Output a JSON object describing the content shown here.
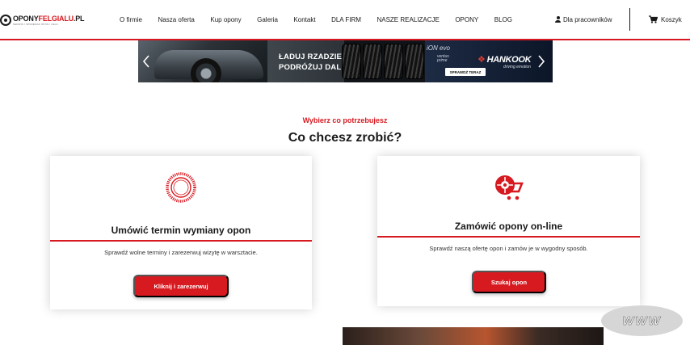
{
  "brand": {
    "title_dark": "OPONY",
    "title_red": "FELGIALU",
    "title_suffix": ".PL",
    "subtitle": "SERWIS I SPRZEDAŻ OPON I FELG",
    "accent_color": "#d71920"
  },
  "nav": {
    "items": [
      {
        "label": "O firmie"
      },
      {
        "label": "Nasza oferta"
      },
      {
        "label": "Kup opony"
      },
      {
        "label": "Galeria"
      },
      {
        "label": "Kontakt"
      },
      {
        "label": "DLA FIRM"
      },
      {
        "label": "NASZE REALIZACJE"
      },
      {
        "label": "OPONY"
      },
      {
        "label": "BLOG"
      }
    ],
    "employees_label": "Dla pracowników",
    "employees_icon": "person-icon",
    "cart_label": "Koszyk",
    "cart_icon": "cart-icon"
  },
  "banner": {
    "slogan_line1": "ŁADUJ RZADZIEJ,",
    "slogan_line2": "PODRÓŻUJ DALEJ",
    "product_line": "iON evo",
    "product_sub1": "ventus",
    "product_sub2": "prime",
    "brand_name": "HANKOOK",
    "brand_tagline": "driving emotion",
    "cta_label": "SPRAWDŹ TERAZ",
    "prev_icon": "chevron-left-icon",
    "next_icon": "chevron-right-icon"
  },
  "section": {
    "kicker": "Wybierz co potrzebujesz",
    "title": "Co chcesz zrobić?"
  },
  "cards": [
    {
      "icon": "tire-icon",
      "title": "Umówić termin wymiany opon",
      "description": "Sprawdź wolne terminy i zarezerwuj wizytę w warsztacie.",
      "button_label": "Kliknij i zarezerwuj"
    },
    {
      "icon": "shopping-cart-wheel-icon",
      "title": "Zamówić opony on-line",
      "description": "Sprawdź naszą ofertę opon i zamów je w wygodny sposób.",
      "button_label": "Szukaj opon"
    }
  ],
  "badge": {
    "label": "WWW"
  }
}
